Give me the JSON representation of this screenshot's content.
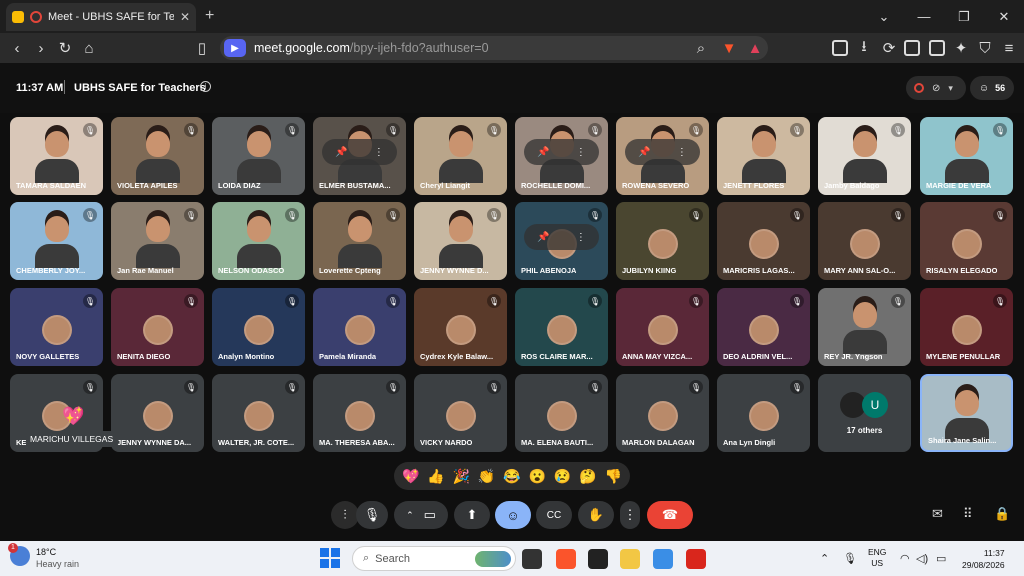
{
  "browser": {
    "tab_title": "Meet - UBHS SAFE for Teachers",
    "url_host": "meet.google.com",
    "url_path": "/bpy-ijeh-fdo?authuser=0"
  },
  "meeting": {
    "time": "11:37 AM",
    "title": "UBHS SAFE for Teachers",
    "participant_count": "56"
  },
  "tiles": [
    {
      "name": "TAMARA SALDAEN",
      "type": "video",
      "bg": "#d9c7b8"
    },
    {
      "name": "VIOLETA APILES",
      "type": "video",
      "bg": "#7e6a56"
    },
    {
      "name": "LOIDA DIAZ",
      "type": "video",
      "bg": "#5b5e60"
    },
    {
      "name": "ELMER BUSTAMA...",
      "type": "video",
      "bg": "#58514a",
      "overlay": true
    },
    {
      "name": "Cheryl Liangit",
      "type": "video",
      "bg": "#b9a58a"
    },
    {
      "name": "ROCHELLE DOMI...",
      "type": "video",
      "bg": "#9a8a80",
      "overlay": true
    },
    {
      "name": "ROWENA SEVERO",
      "type": "video",
      "bg": "#b89c80",
      "overlay": true
    },
    {
      "name": "JENETT FLORES",
      "type": "video",
      "bg": "#cdb9a0"
    },
    {
      "name": "Jamby Baldago",
      "type": "video",
      "bg": "#e1dcd4"
    },
    {
      "name": "MARGIE DE VERA",
      "type": "video",
      "bg": "#8fc4cc"
    },
    {
      "name": "CHEMBERLY JOY...",
      "type": "video",
      "bg": "#8fb8d8"
    },
    {
      "name": "Jan Rae Manuel",
      "type": "video",
      "bg": "#8a7d6e"
    },
    {
      "name": "NELSON ODASCO",
      "type": "video",
      "bg": "#8fb095"
    },
    {
      "name": "Loverette Cpteng",
      "type": "video",
      "bg": "#7a6650"
    },
    {
      "name": "JENNY WYNNE D...",
      "type": "video",
      "bg": "#c7b8a2"
    },
    {
      "name": "PHIL ABENOJA",
      "type": "avatar",
      "bg": "#2c4a5a",
      "overlay": true
    },
    {
      "name": "JUBILYN KIING",
      "type": "avatar",
      "bg": "#4a4630"
    },
    {
      "name": "MARICRIS LAGAS...",
      "type": "avatar",
      "bg": "#4a3a30"
    },
    {
      "name": "MARY ANN SAL-O...",
      "type": "avatar",
      "bg": "#4a3a30"
    },
    {
      "name": "RISALYN ELEGADO",
      "type": "avatar",
      "bg": "#5a3a34"
    },
    {
      "name": "NOVY GALLETES",
      "type": "avatar",
      "bg": "#3a3f6e"
    },
    {
      "name": "NENITA DIEGO",
      "type": "avatar",
      "bg": "#5a2838"
    },
    {
      "name": "Analyn Montino",
      "type": "avatar",
      "bg": "#25385a"
    },
    {
      "name": "Pamela Miranda",
      "type": "avatar",
      "bg": "#3a3f6e"
    },
    {
      "name": "Cydrex Kyle Balaw...",
      "type": "avatar",
      "bg": "#5a3a2a"
    },
    {
      "name": "ROS CLAIRE MAR...",
      "type": "avatar",
      "bg": "#23484c"
    },
    {
      "name": "ANNA MAY VIZCA...",
      "type": "avatar",
      "bg": "#5a2838"
    },
    {
      "name": "DEO ALDRIN VEL...",
      "type": "avatar",
      "bg": "#4a2a44"
    },
    {
      "name": "REY JR. Yngson",
      "type": "video",
      "bg": "#707070"
    },
    {
      "name": "MYLENE PENULLAR",
      "type": "avatar",
      "bg": "#5a2028"
    },
    {
      "name": "KE",
      "type": "avatar",
      "bg": "#3c4043",
      "heart": true
    },
    {
      "name": "JENNY WYNNE DA...",
      "type": "avatar",
      "bg": "#3c4043"
    },
    {
      "name": "WALTER, JR. COTE...",
      "type": "avatar",
      "bg": "#3c4043"
    },
    {
      "name": "MA. THERESA ABA...",
      "type": "avatar",
      "bg": "#3c4043"
    },
    {
      "name": "VICKY NARDO",
      "type": "avatar",
      "bg": "#3c4043"
    },
    {
      "name": "MA. ELENA BAUTI...",
      "type": "avatar",
      "bg": "#3c4043"
    },
    {
      "name": "MARLON DALAGAN",
      "type": "avatar",
      "bg": "#3c4043"
    },
    {
      "name": "Ana Lyn Dingli",
      "type": "avatar",
      "bg": "#3c4043"
    },
    {
      "name": "17 others",
      "type": "others",
      "bg": "#3c4043",
      "others_initial": "U"
    },
    {
      "name": "Shaira Jane Salin...",
      "type": "self",
      "bg": "#a8bcc6"
    }
  ],
  "tooltip": "MARICHU VILLEGAS",
  "reactions": [
    "💖",
    "👍",
    "🎉",
    "👏",
    "😂",
    "😮",
    "😢",
    "🤔",
    "👎"
  ],
  "taskbar": {
    "temperature": "18°C",
    "weather": "Heavy rain",
    "weather_badge": "1",
    "search_placeholder": "Search",
    "lang_line1": "ENG",
    "lang_line2": "US",
    "clock_time": "11:37",
    "clock_date": "29/08/2026"
  }
}
